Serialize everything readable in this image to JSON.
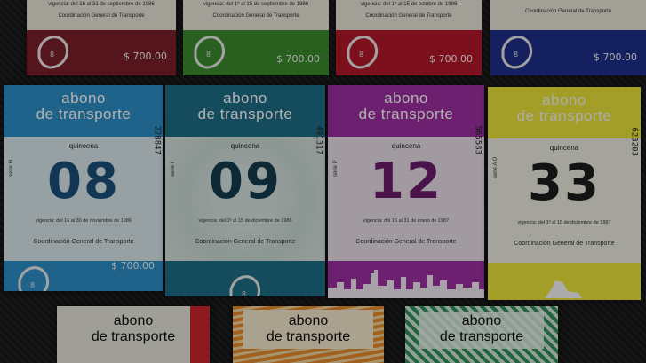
{
  "top_row": [
    {
      "vigencia": "vigencia: del 16 al 31 de septiembre de 1986",
      "coord": "Coordinación General de Transporte",
      "price": "$ 700.00",
      "color": "#7a1f2a"
    },
    {
      "vigencia": "vigencia: del 1º al 15 de septiembre de 1986",
      "coord": "Coordinación General de Transporte",
      "price": "$ 700.00",
      "color": "#3c8a2e"
    },
    {
      "vigencia": "vigencia: del 1º al 15 de octubre de 1986",
      "coord": "Coordinación General de Transporte",
      "price": "$ 700.00",
      "color": "#b3182a"
    },
    {
      "vigencia": "",
      "coord": "Coordinación General de Transporte",
      "price": "$ 700.00",
      "color": "#1f2f8a"
    }
  ],
  "middle_row": [
    {
      "title1": "abono",
      "title2": "de transporte",
      "quincena": "quincena",
      "number": "08",
      "serie": "serie H",
      "serial": "228847",
      "vigencia": "vigencia: del 16 al 30 de noviembre de 1986",
      "coord": "Coordinación General de Transporte",
      "price": "$ 700.00",
      "color": "#2f8fc6",
      "num_color": "#1b4f7a"
    },
    {
      "title1": "abono",
      "title2": "de transporte",
      "quincena": "quincena",
      "number": "09",
      "serie": "serie I",
      "serial": "491317",
      "vigencia": "vigencia: del 1º al 15 de diciembre de 1986",
      "coord": "Coordinación General de Transporte",
      "price": "",
      "color": "#1f6d86",
      "num_color": "#123c4c"
    },
    {
      "title1": "abono",
      "title2": "de transporte",
      "quincena": "quincena",
      "number": "12",
      "serie": "serie P",
      "serial": "565583",
      "vigencia": "vigencia: del 16 al 31 de enero de 1987",
      "coord": "Coordinación General de Transporte",
      "price": "",
      "color": "#9b2f9f",
      "num_color": "#6a1d6b"
    },
    {
      "title1": "abono",
      "title2": "de transporte",
      "quincena": "quincena",
      "number": "33",
      "serie": "serie A O",
      "serial": "623203",
      "vigencia": "vigencia: del 1º al 15 de diciembre de 1987",
      "coord": "Coordinación General de Transporte",
      "price": "",
      "color": "#e9e23a",
      "num_color": "#1c1c1c"
    }
  ],
  "bottom_row": [
    {
      "title1": "abono",
      "title2": "de transporte",
      "color": "#39a24a"
    },
    {
      "title1": "abono",
      "title2": "de transporte",
      "color": "#e58a2c"
    },
    {
      "title1": "abono",
      "title2": "de transporte",
      "color": "#2e8f5a"
    }
  ]
}
